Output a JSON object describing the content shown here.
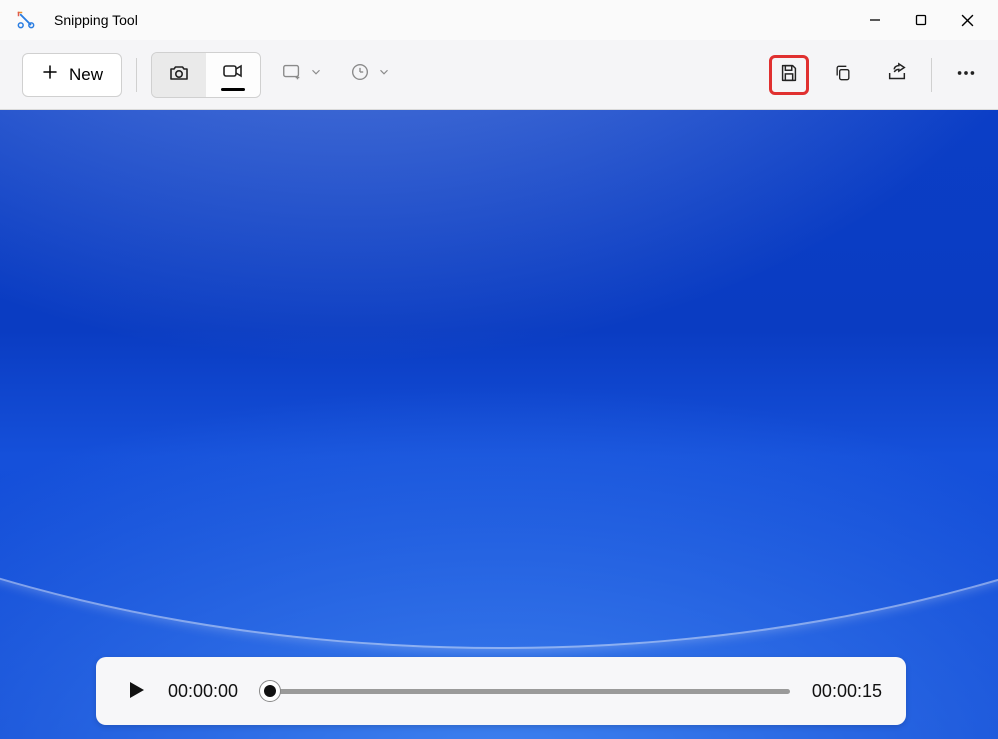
{
  "app": {
    "title": "Snipping Tool"
  },
  "toolbar": {
    "new_label": "New"
  },
  "player": {
    "current_time": "00:00:00",
    "duration": "00:00:15"
  }
}
